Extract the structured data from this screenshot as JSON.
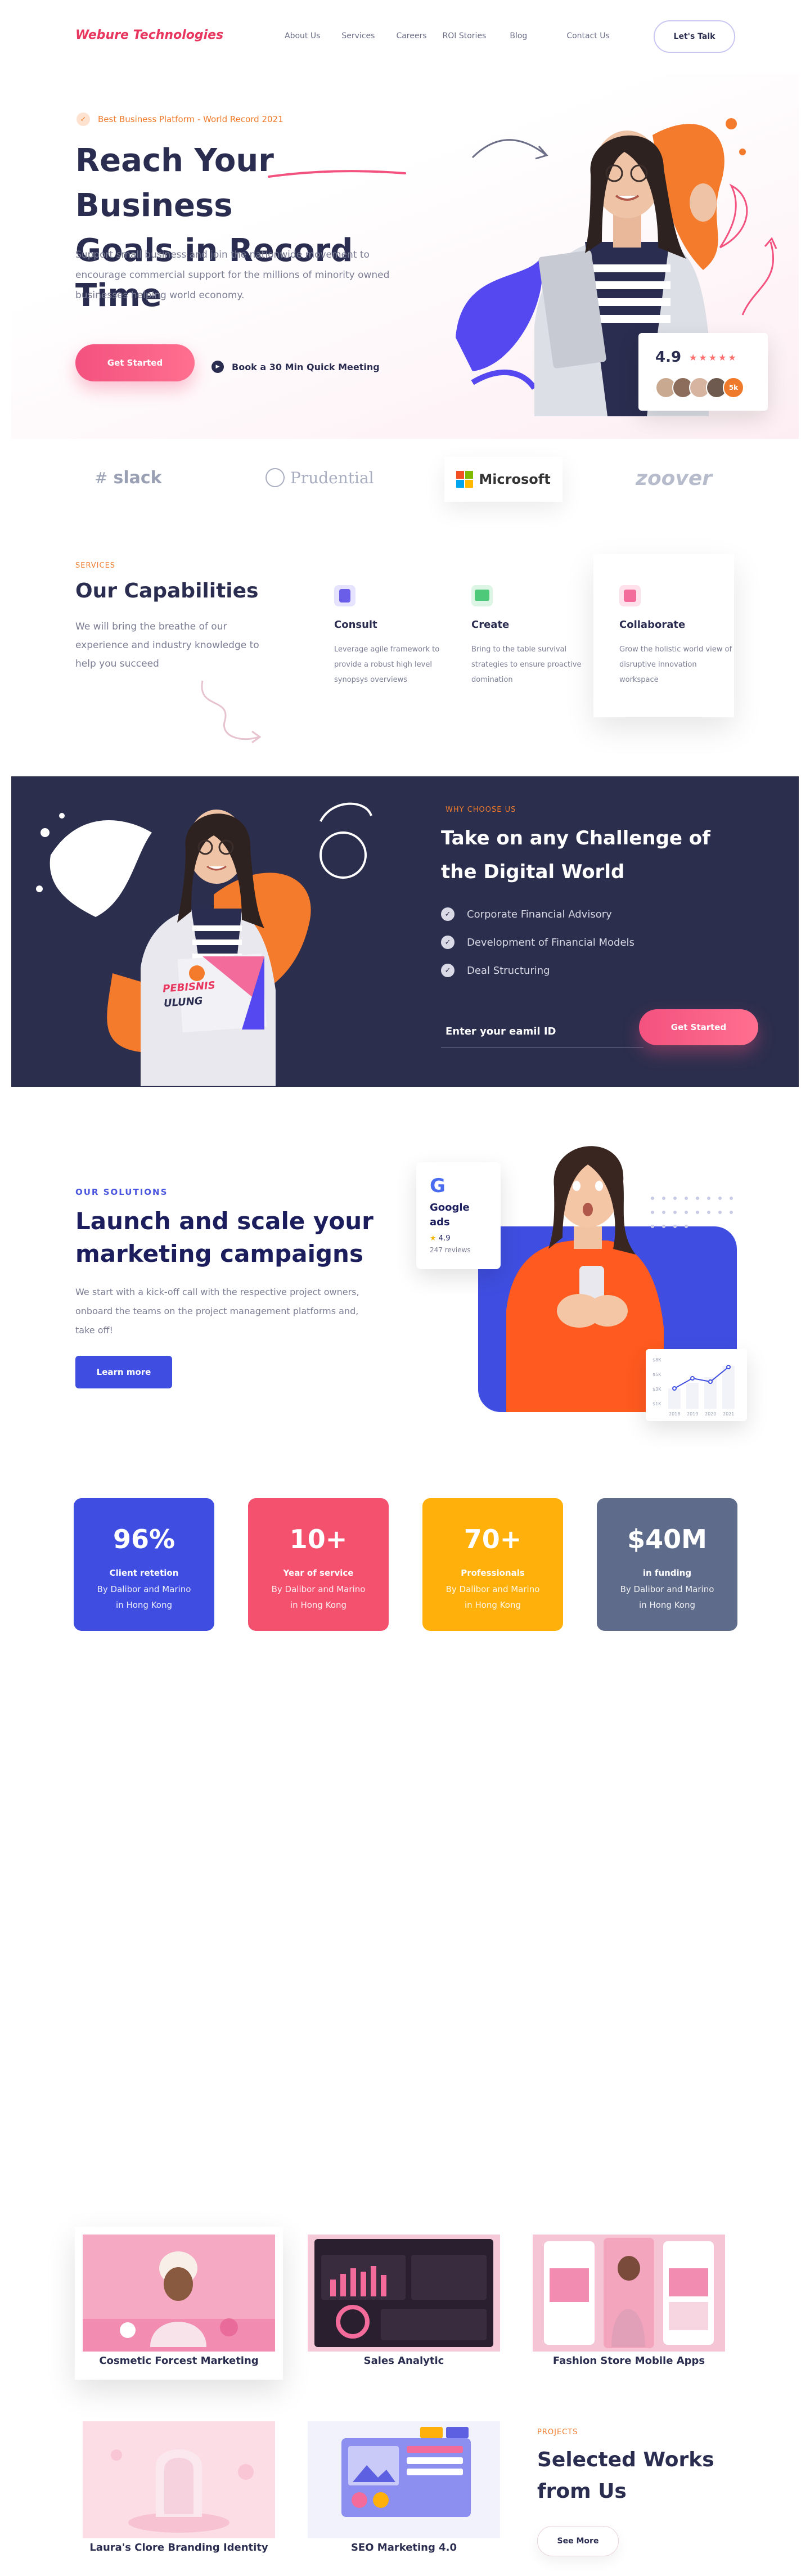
{
  "nav": {
    "brand": "Webure Technologies",
    "links": [
      "About Us",
      "Services",
      "Careers",
      "ROI Stories",
      "Blog",
      "Contact Us"
    ],
    "cta": "Let's Talk"
  },
  "hero": {
    "badge": "Best Business Platform - World Record 2021",
    "title_line1": "Reach Your Business",
    "title_line2": "Goals in Record Time",
    "description": "Support small business and join the nationwide movement to encourage commercial support for the millions of minority owned businesses helping world economy.",
    "primary_button": "Get Started",
    "secondary_button": "Book a 30 Min Quick Meeting",
    "rating": {
      "value": "4.9",
      "stars": "★★★★★",
      "more_label": "5k"
    }
  },
  "logos": [
    "slack",
    "Prudential",
    "Microsoft",
    "zoover"
  ],
  "capabilities": {
    "label": "SERVICES",
    "title": "Our Capabilities",
    "description": "We will bring the breathe of our experience and industry knowledge to help you succeed",
    "items": [
      {
        "title": "Consult",
        "text": "Leverage agile framework to provide a robust high level synopsys overviews",
        "icon": "consult-icon",
        "color": "#6a5de8"
      },
      {
        "title": "Create",
        "text": "Bring to the table survival strategies to ensure proactive domination",
        "icon": "create-icon",
        "color": "#4ec97a"
      },
      {
        "title": "Collaborate",
        "text": "Grow the holistic world view of disruptive innovation workspace",
        "icon": "collaborate-icon",
        "color": "#f36b9b"
      }
    ]
  },
  "challenge": {
    "label": "WHY CHOOSE US",
    "title": "Take on any Challenge of the Digital World",
    "items": [
      "Corporate Financial Advisory",
      "Development of Financial Models",
      "Deal Structuring"
    ],
    "email_label": "Enter your eamil ID",
    "button": "Get Started",
    "sign_line1": "PEBISNIS",
    "sign_line2": "ULUNG"
  },
  "solutions": {
    "label": "OUR SOLUTIONS",
    "title": "Launch and scale your marketing campaigns",
    "description": "We start with a kick-off call with the respective project owners, onboard the teams on the project management platforms and, take off!",
    "button": "Learn more",
    "google_card": {
      "logo": "G",
      "title_line1": "Google",
      "title_line2": "ads",
      "rating": "4.9",
      "star": "★",
      "reviews": "247 reviews"
    },
    "mini_chart": {
      "y_ticks": [
        "$8K",
        "$5K",
        "$3K",
        "$1K"
      ],
      "x_ticks": [
        "2018",
        "2019",
        "2020",
        "2021"
      ]
    }
  },
  "stats": [
    {
      "value": "96%",
      "label": "Client retetion",
      "desc1": "By Dalibor and Marino",
      "desc2": "in Hong Kong",
      "color": "#3f4ee0"
    },
    {
      "value": "10+",
      "label": "Year of service",
      "desc1": "By Dalibor and Marino",
      "desc2": "in Hong Kong",
      "color": "#f4516f"
    },
    {
      "value": "70+",
      "label": "Professionals",
      "desc1": "By Dalibor and Marino",
      "desc2": "in Hong Kong",
      "color": "#ffb00a"
    },
    {
      "value": "$40M",
      "label": "in funding",
      "desc1": "By Dalibor and Marino",
      "desc2": "in Hong Kong",
      "color": "#5f6b8a"
    }
  ],
  "works": {
    "items": [
      "Cosmetic Forcest Marketing",
      "Sales Analytic",
      "Fashion Store Mobile Apps",
      "Laura's Clore Branding Identity",
      "SEO Marketing 4.0"
    ],
    "label": "PROJECTS",
    "title_line1": "Selected Works",
    "title_line2": "from Us",
    "button": "See More"
  }
}
